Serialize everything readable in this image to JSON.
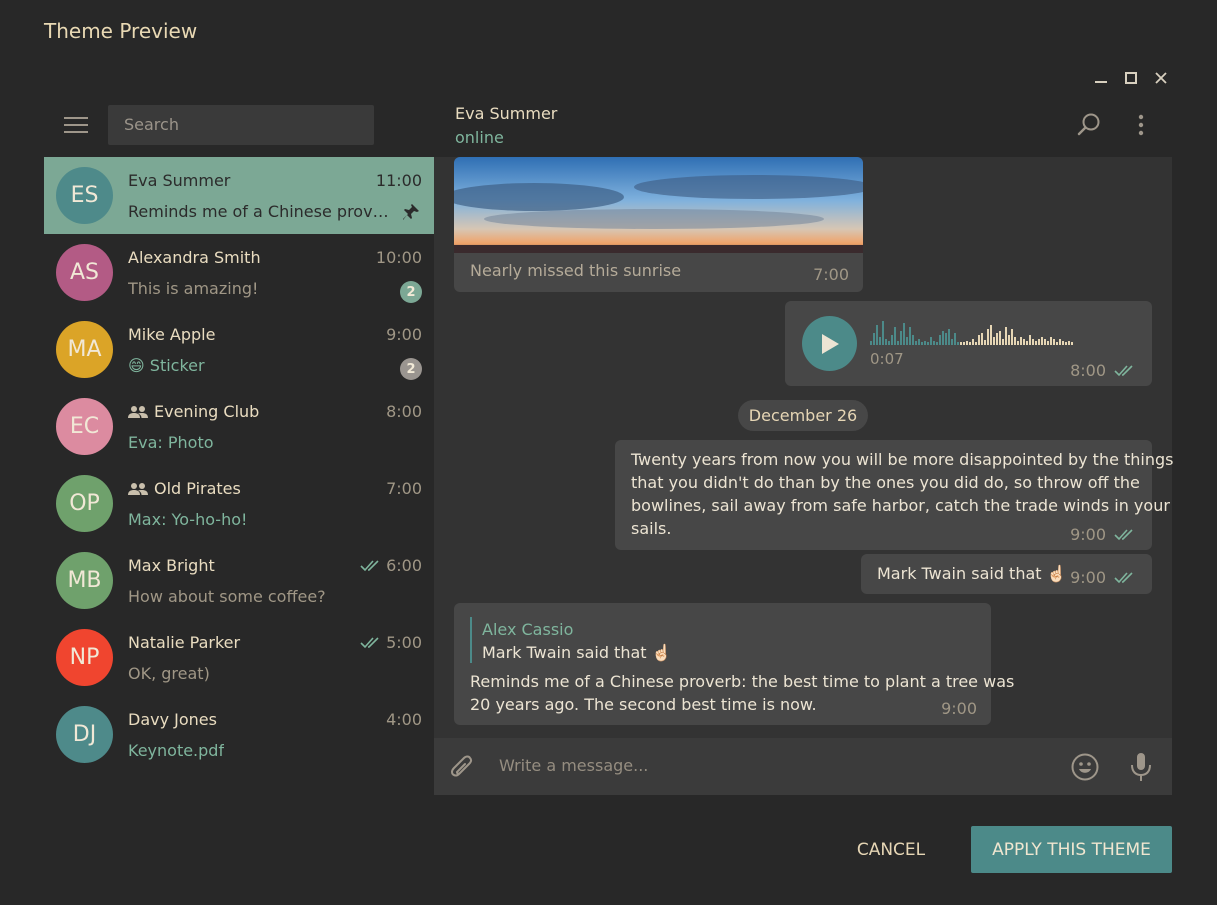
{
  "dialog": {
    "title": "Theme Preview"
  },
  "window_controls": {
    "minimize_icon": "minimize-icon",
    "maximize_icon": "maximize-icon",
    "close_icon": "close-icon"
  },
  "sidebar": {
    "menu_icon": "hamburger-menu-icon",
    "search_placeholder": "Search",
    "chats": [
      {
        "initials": "ES",
        "name": "Eva Summer",
        "time": "11:00",
        "message": "Reminds me of a Chinese prover...",
        "pinned": true,
        "avatar_color": "#4e8a8a"
      },
      {
        "initials": "AS",
        "name": "Alexandra Smith",
        "time": "10:00",
        "message": "This is amazing!",
        "unread": "2",
        "avatar_color": "#b35b85"
      },
      {
        "initials": "MA",
        "name": "Mike Apple",
        "time": "9:00",
        "emoji": "😄",
        "message": "Sticker",
        "unread": "2",
        "avatar_color": "#dba427"
      },
      {
        "initials": "EC",
        "name": "Evening Club",
        "time": "8:00",
        "message": "Eva: Photo",
        "group": true,
        "avatar_color": "#dc8ba0"
      },
      {
        "initials": "OP",
        "name": "Old Pirates",
        "time": "7:00",
        "message": "Max: Yo-ho-ho!",
        "group": true,
        "avatar_color": "#6fa16c"
      },
      {
        "initials": "MB",
        "name": "Max Bright",
        "time": "6:00",
        "message": "How about some coffee?",
        "read": true,
        "avatar_color": "#6fa16c"
      },
      {
        "initials": "NP",
        "name": "Natalie Parker",
        "time": "5:00",
        "message": "OK, great)",
        "read": true,
        "avatar_color": "#f0452f"
      },
      {
        "initials": "DJ",
        "name": "Davy Jones",
        "time": "4:00",
        "message": "Keynote.pdf",
        "avatar_color": "#4e8a8a"
      }
    ]
  },
  "chat": {
    "peer_name": "Eva Summer",
    "peer_status": "online",
    "search_icon": "search-icon",
    "more_icon": "more-vertical-icon",
    "photo_caption": "Nearly missed this sunrise",
    "photo_time": "7:00",
    "voice": {
      "duration": "0:07",
      "time": "8:00"
    },
    "date": "December 26",
    "long_message": {
      "line1": "Twenty years from now you will be more disappointed by the things",
      "line2": "that you didn't do than by the ones you did do, so throw off the",
      "line3": "bowlines, sail away from safe harbor, catch the trade winds in your",
      "line4": "sails.",
      "time": "9:00"
    },
    "short_message": {
      "text": "Mark Twain said that ☝🏻",
      "time": "9:00"
    },
    "reply_message": {
      "quote_author": "Alex Cassio",
      "quote_text": "Mark Twain said that ☝🏻",
      "line1": "Reminds me of a Chinese proverb: the best time to plant a tree was",
      "line2": "20 years ago. The second best time is now.",
      "time": "9:00"
    },
    "composer": {
      "placeholder": "Write a message...",
      "attach_icon": "paperclip-icon",
      "emoji_icon": "emoji-icon",
      "mic_icon": "microphone-icon"
    }
  },
  "actions": {
    "cancel": "CANCEL",
    "apply": "APPLY THIS THEME"
  },
  "colors": {
    "accent": "#4c8a89",
    "active_chat": "#7ca895",
    "online": "#7fb59d",
    "background": "#282828"
  }
}
